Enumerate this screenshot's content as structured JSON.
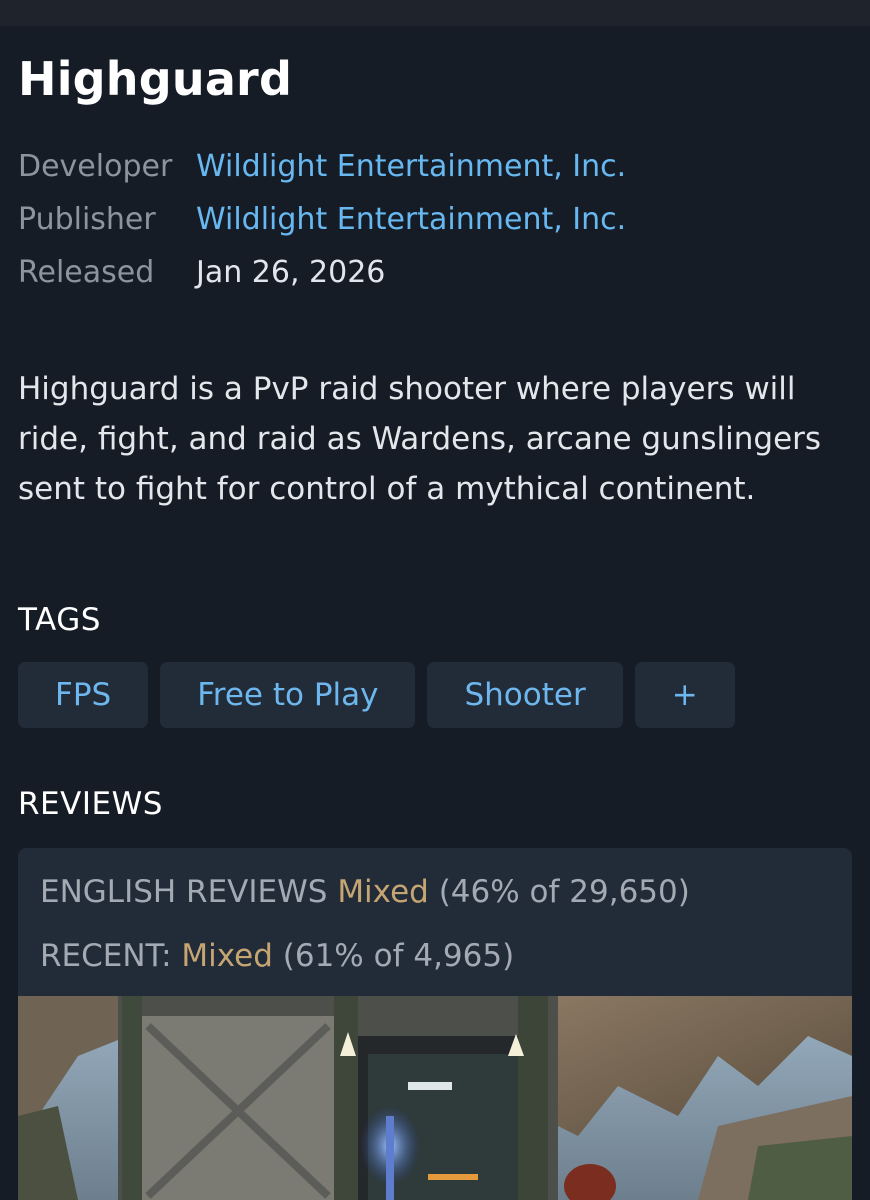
{
  "app": {
    "title": "Highguard"
  },
  "meta": {
    "developer_label": "Developer",
    "developer_value": "Wildlight Entertainment, Inc.",
    "publisher_label": "Publisher",
    "publisher_value": "Wildlight Entertainment, Inc.",
    "released_label": "Released",
    "released_value": "Jan 26, 2026"
  },
  "description": "Highguard is a PvP raid shooter where players will ride, fight, and raid as Wardens, arcane gunslingers sent to fight for control of a mythical continent.",
  "tags": {
    "heading": "TAGS",
    "items": [
      "FPS",
      "Free to Play",
      "Shooter",
      "+"
    ]
  },
  "reviews": {
    "heading": "REVIEWS",
    "english_label": "ENGLISH REVIEWS",
    "english_rating": "Mixed",
    "english_detail": "(46% of 29,650)",
    "recent_label": "RECENT:",
    "recent_rating": "Mixed",
    "recent_detail": "(61% of 4,965)"
  },
  "colors": {
    "background": "#161c26",
    "link": "#67b8f0",
    "mixed_rating": "#c5a572",
    "card": "#222b38"
  }
}
